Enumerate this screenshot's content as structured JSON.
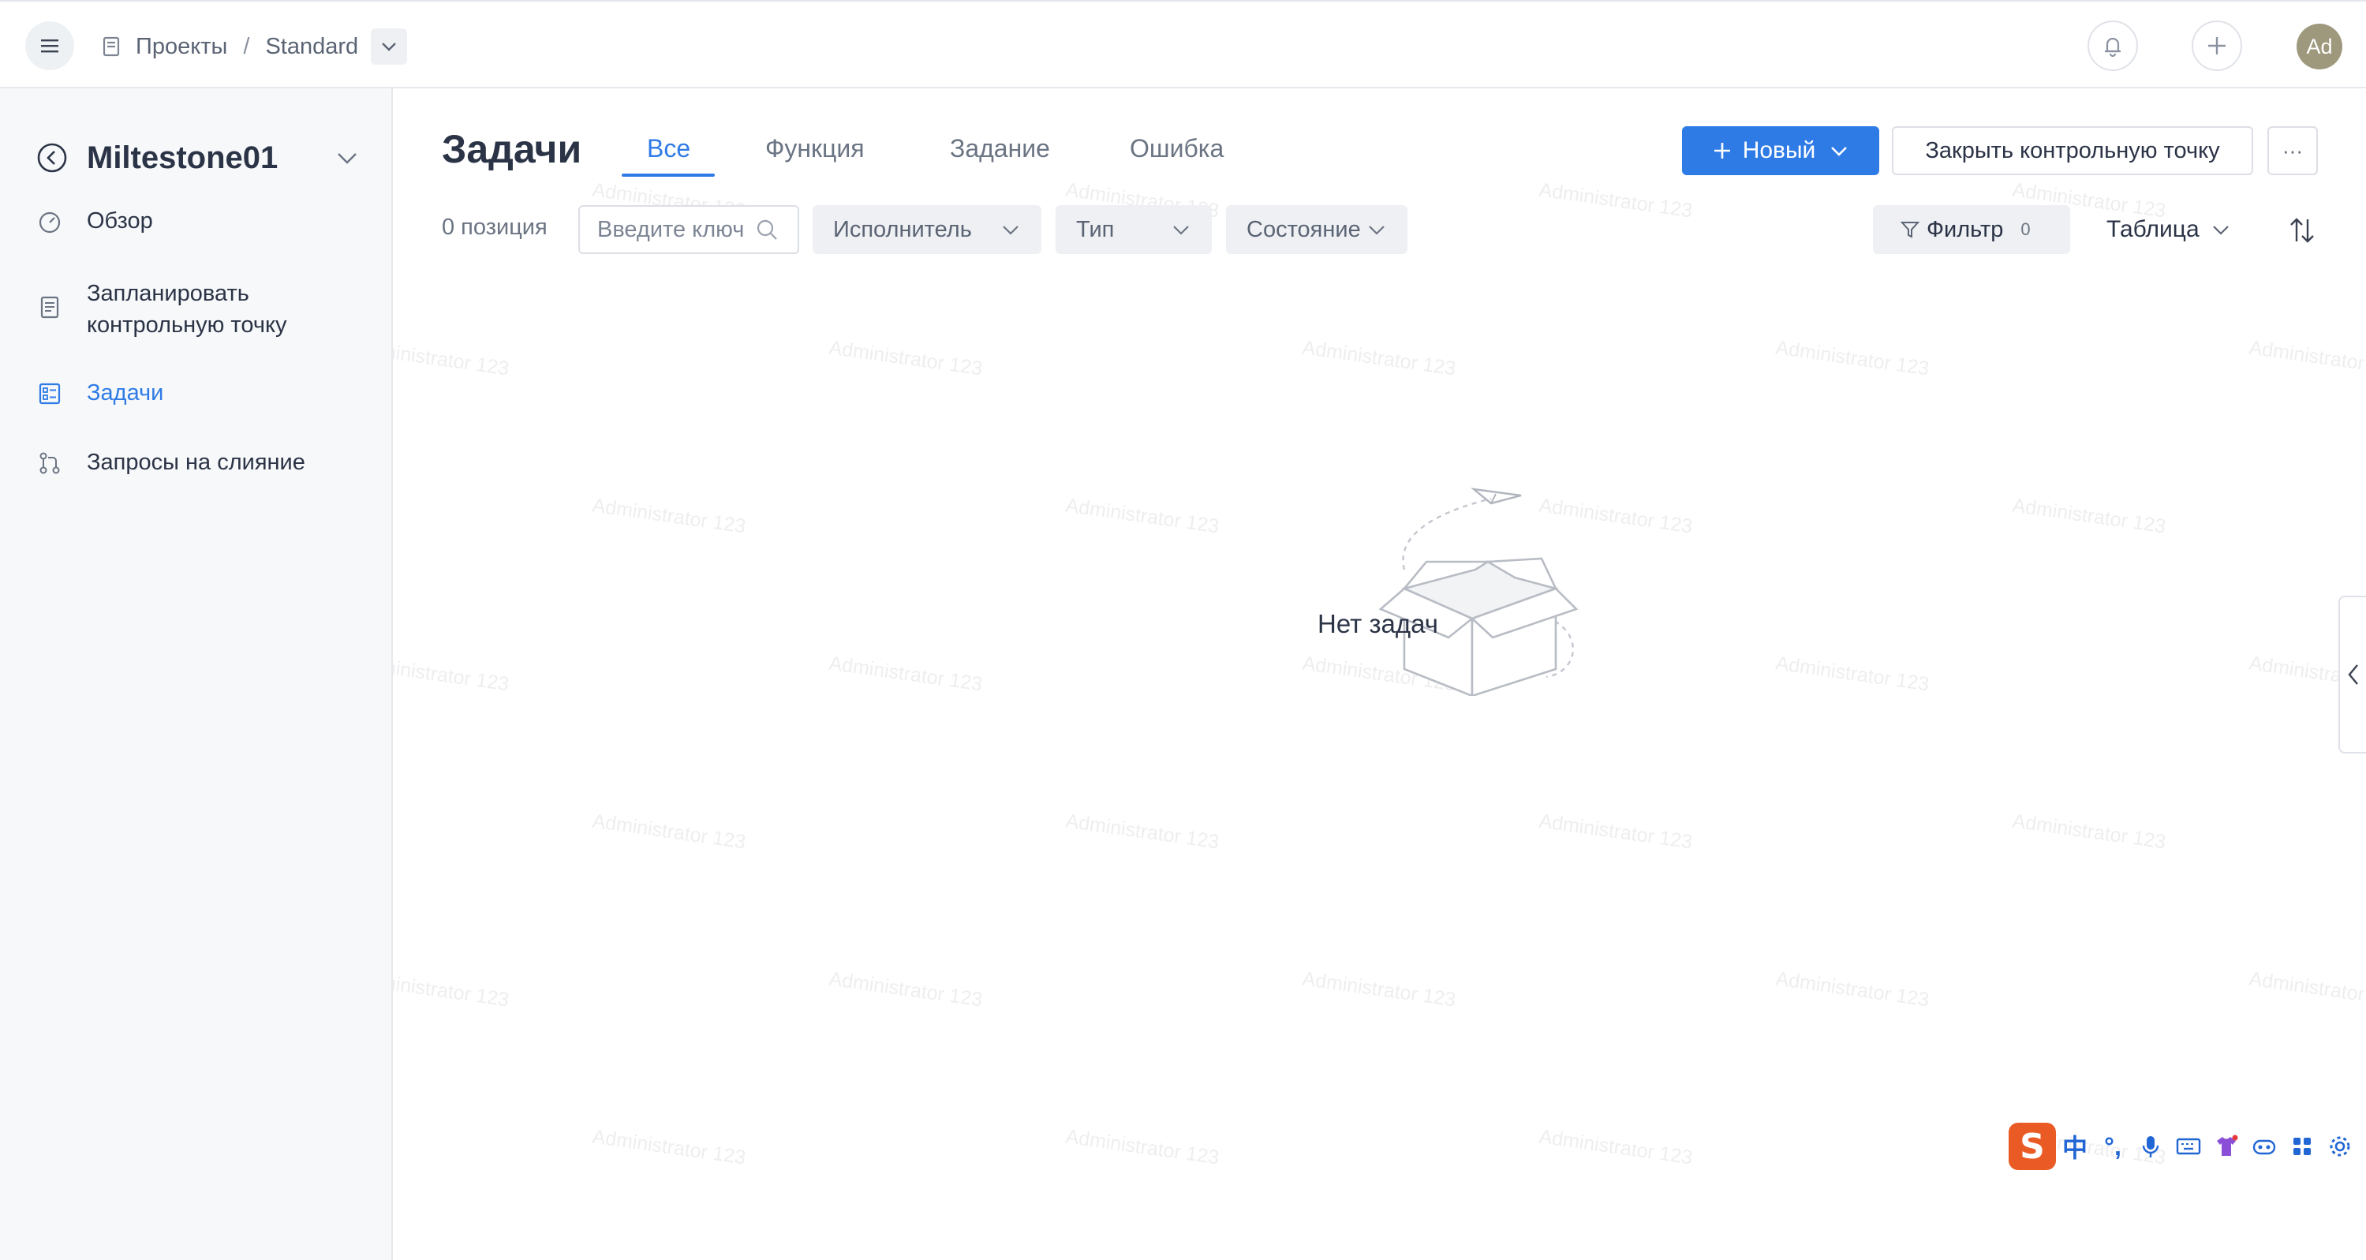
{
  "header": {
    "breadcrumb": {
      "projects": "Проекты",
      "separator": "/",
      "project": "Standard"
    },
    "avatar_initials": "Ad"
  },
  "sidebar": {
    "milestone_title": "Miltestone01",
    "items": [
      {
        "label": "Обзор",
        "icon": "dashboard-icon",
        "active": false
      },
      {
        "label": "Запланировать контрольную точку",
        "icon": "plan-icon",
        "active": false
      },
      {
        "label": "Задачи",
        "icon": "tasks-icon",
        "active": true
      },
      {
        "label": "Запросы на слияние",
        "icon": "merge-request-icon",
        "active": false
      }
    ]
  },
  "main": {
    "title": "Задачи",
    "tabs": [
      {
        "label": "Все",
        "active": true
      },
      {
        "label": "Функция",
        "active": false
      },
      {
        "label": "Задание",
        "active": false
      },
      {
        "label": "Ошибка",
        "active": false
      }
    ],
    "new_button": "Новый",
    "close_milestone_button": "Закрыть контрольную точку",
    "more_button": "···",
    "count_text": "0 позиция",
    "search_placeholder": "Введите ключ",
    "filters": {
      "assignee": "Исполнитель",
      "type": "Тип",
      "status": "Состояние"
    },
    "filter_button": "Фильтр",
    "filter_count": "0",
    "view_mode": "Таблица",
    "empty_text": "Нет задач"
  },
  "ime": {
    "logo": "S",
    "lang": "中",
    "punct": "°,"
  },
  "watermark": "Administrator 123",
  "colors": {
    "accent": "#2f7be6",
    "avatar": "#9e987c",
    "ime_logo": "#ea5a24"
  }
}
